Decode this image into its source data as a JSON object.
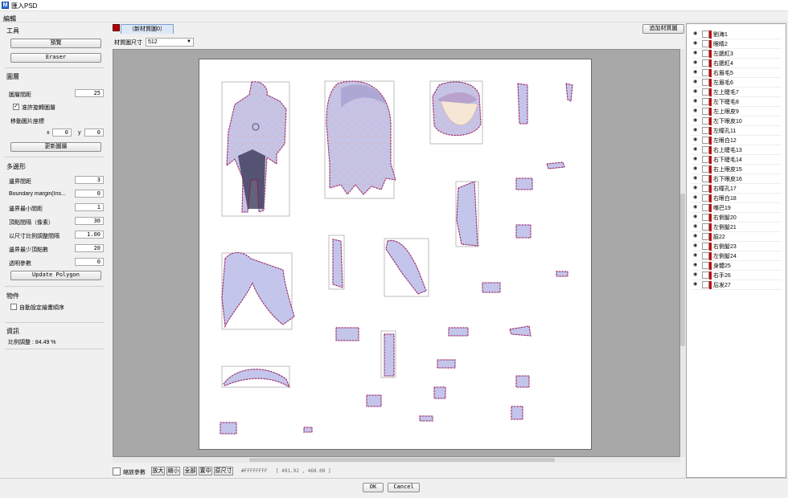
{
  "window": {
    "title": "匯入PSD"
  },
  "menu": {
    "edit": "編輯"
  },
  "tools": {
    "section_title": "工具",
    "preview_label": "預覽",
    "eraser_label": "Eraser"
  },
  "layer_settings": {
    "section_title": "圖層",
    "spacing_label": "圖層間距",
    "spacing_value": "25",
    "allow_rotate_label": "准許旋轉圖層",
    "allow_rotate_checked": true,
    "move_label": "移動圖片座標",
    "x_label": "x",
    "x_value": "0",
    "y_label": "y",
    "y_value": "0",
    "update_label": "更新圖層"
  },
  "polygon": {
    "section_title": "多邊形",
    "fields": [
      {
        "label": "邊界間距",
        "value": "3"
      },
      {
        "label": "Boundary margin(Ins...",
        "value": "0"
      },
      {
        "label": "邊界最小間距",
        "value": "1"
      },
      {
        "label": "頂點間隔（像素）",
        "value": "30"
      },
      {
        "label": "以尺寸比例調整間隔",
        "value": "1.00"
      },
      {
        "label": "邊界最少頂點數",
        "value": "20"
      },
      {
        "label": "透明參數",
        "value": "0"
      }
    ],
    "update_label": "Update Polygon"
  },
  "object": {
    "section_title": "物件",
    "auto_order_label": "自動設定繪畫順序",
    "auto_order_checked": false
  },
  "info": {
    "section_title": "資訊",
    "ratio_label": "比例調整 : 84.49 %"
  },
  "texture": {
    "tab_label": "（新材質圖0）",
    "add_label": "追加材質圖",
    "size_label": "材質圖尺寸",
    "size_value": "512"
  },
  "bottom": {
    "scale_param_label": "縮放參數",
    "zoom_in": "放大",
    "zoom_out": "縮小",
    "fit_all": "全部",
    "center": "置中",
    "original": "原尺寸",
    "color_readout": "#FFFFFFFF",
    "coord_readout": "[ 491.92 , 468.08 ]"
  },
  "layers": [
    "劉海1",
    "眼睛2",
    "左腮紅3",
    "右腮紅4",
    "右眉毛5",
    "左眉毛6",
    "左上睫毛7",
    "左下睫毛8",
    "左上眼皮9",
    "左下眼皮10",
    "左瞳孔11",
    "左眼白12",
    "右上睫毛13",
    "右下睫毛14",
    "右上眼皮15",
    "右下眼皮16",
    "右瞳孔17",
    "右眼白18",
    "嘴巴19",
    "右側髮20",
    "左側髮21",
    "臉22",
    "右側髮23",
    "左側髮24",
    "身體25",
    "右手26",
    "后发27"
  ],
  "footer": {
    "ok_label": "OK",
    "cancel_label": "Cancel"
  },
  "colors": {
    "mesh_point": "#d4003c",
    "piece_fill": "#bcc0e6",
    "bbox": "#9a9a9a",
    "layer_tag": "#c00000"
  }
}
